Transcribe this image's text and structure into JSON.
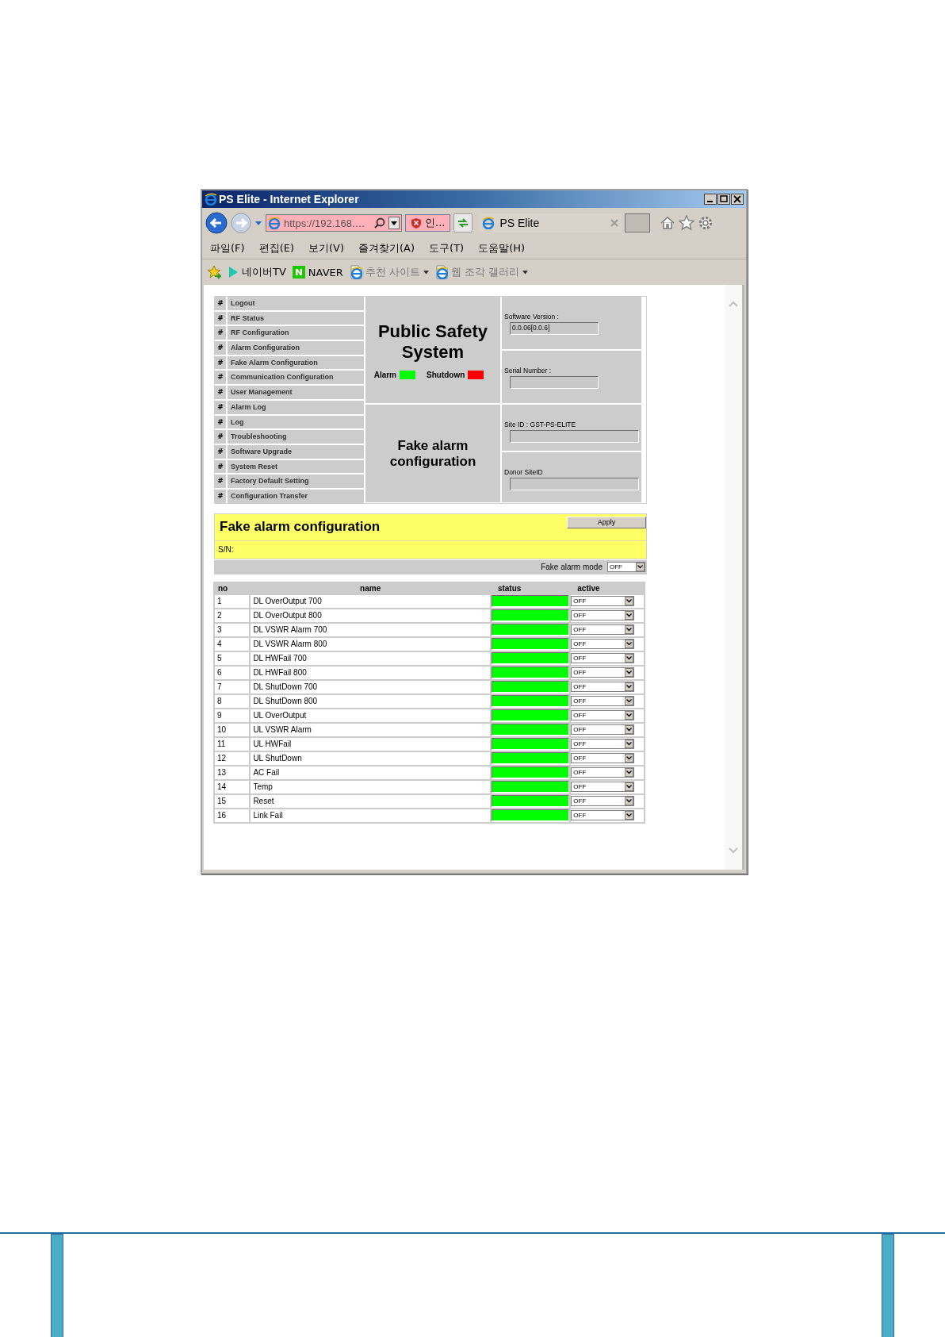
{
  "window": {
    "title": "PS Elite - Internet Explorer",
    "address": "https://192.168.…",
    "security_badge": "인...",
    "tab": {
      "title": "PS Elite"
    }
  },
  "menu_bar": [
    "파일(F)",
    "편집(E)",
    "보기(V)",
    "즐겨찾기(A)",
    "도구(T)",
    "도움말(H)"
  ],
  "favorites_bar": [
    {
      "kind": "play",
      "label": "네이버TV"
    },
    {
      "kind": "naver",
      "label": "NAVER"
    },
    {
      "kind": "ie-dropdown",
      "label": "추천 사이트"
    },
    {
      "kind": "ie-dropdown",
      "label": "웹 조각 갤러리"
    }
  ],
  "sidebar": {
    "items": [
      {
        "bullet": "#",
        "label": "Logout"
      },
      {
        "bullet": "#",
        "label": "RF Status"
      },
      {
        "bullet": "#",
        "label": "RF Configuration"
      },
      {
        "bullet": "#",
        "label": "Alarm Configuration"
      },
      {
        "bullet": "#",
        "label": "Fake Alarm Configuration"
      },
      {
        "bullet": "#",
        "label": "Communication Configuration"
      },
      {
        "bullet": "#",
        "label": "User Management"
      },
      {
        "bullet": "#",
        "label": "Alarm Log"
      },
      {
        "bullet": "#",
        "label": "Log"
      },
      {
        "bullet": "#",
        "label": "Troubleshooting"
      },
      {
        "bullet": "#",
        "label": "Software Upgrade"
      },
      {
        "bullet": "#",
        "label": "System Reset"
      },
      {
        "bullet": "#",
        "label": "Factory Default Setting"
      },
      {
        "bullet": "#",
        "label": "Configuration Transfer"
      }
    ]
  },
  "header": {
    "system_title": "Public Safety System",
    "indicators": [
      {
        "label": "Alarm",
        "color": "#00ff00"
      },
      {
        "label": "Shutdown",
        "color": "#ff0000"
      }
    ],
    "page_title": "Fake alarm configuration",
    "info": [
      {
        "label": "Software Version :",
        "value": "0.0.06[0.0.6]"
      },
      {
        "label": "Serial Number :"
      },
      {
        "label": "Site ID : GST-PS-ELITE"
      },
      {
        "label": "Donor SiteID"
      }
    ]
  },
  "panel": {
    "title": "Fake alarm configuration",
    "apply_button": "Apply",
    "serial_label": "S/N:",
    "mode_label": "Fake alarm mode",
    "mode_value": "OFF"
  },
  "table": {
    "columns": [
      "no",
      "name",
      "status",
      "active"
    ],
    "rows": [
      {
        "no": "1",
        "name": "DL OverOutput 700",
        "color": "#00ff00",
        "active": "OFF"
      },
      {
        "no": "2",
        "name": "DL OverOutput 800",
        "color": "#00ff00",
        "active": "OFF"
      },
      {
        "no": "3",
        "name": "DL VSWR Alarm 700",
        "color": "#00ff00",
        "active": "OFF"
      },
      {
        "no": "4",
        "name": "DL VSWR Alarm 800",
        "color": "#00ff00",
        "active": "OFF"
      },
      {
        "no": "5",
        "name": "DL HWFail 700",
        "color": "#00ff00",
        "active": "OFF"
      },
      {
        "no": "6",
        "name": "DL HWFail 800",
        "color": "#00ff00",
        "active": "OFF"
      },
      {
        "no": "7",
        "name": "DL ShutDown 700",
        "color": "#00ff00",
        "active": "OFF"
      },
      {
        "no": "8",
        "name": "DL ShutDown 800",
        "color": "#00ff00",
        "active": "OFF"
      },
      {
        "no": "9",
        "name": "UL OverOutput",
        "color": "#00ff00",
        "active": "OFF"
      },
      {
        "no": "10",
        "name": "UL VSWR Alarm",
        "color": "#00ff00",
        "active": "OFF"
      },
      {
        "no": "11",
        "name": "UL HWFail",
        "color": "#00ff00",
        "active": "OFF"
      },
      {
        "no": "12",
        "name": "UL ShutDown",
        "color": "#00ff00",
        "active": "OFF"
      },
      {
        "no": "13",
        "name": "AC Fail",
        "color": "#00ff00",
        "active": "OFF"
      },
      {
        "no": "14",
        "name": "Temp",
        "color": "#00ff00",
        "active": "OFF"
      },
      {
        "no": "15",
        "name": "Reset",
        "color": "#00ff00",
        "active": "OFF"
      },
      {
        "no": "16",
        "name": "Link Fail",
        "color": "#00ff00",
        "active": "OFF"
      }
    ]
  }
}
